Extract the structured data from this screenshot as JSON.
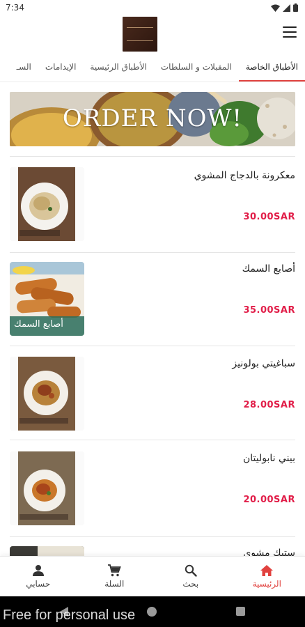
{
  "status_bar": {
    "time": "7:34"
  },
  "header": {
    "logo_icon": "restaurant-logo",
    "menu_icon": "hamburger-icon"
  },
  "tabs": [
    {
      "label": "الأطباق الخاصة",
      "active": true
    },
    {
      "label": "المقبلات و السلطات",
      "active": false
    },
    {
      "label": "الأطباق الرئيسية",
      "active": false
    },
    {
      "label": "الإيدامات",
      "active": false
    },
    {
      "label": "السـ",
      "active": false
    }
  ],
  "banner": {
    "text": "ORDER NOW!"
  },
  "items": [
    {
      "name": "معكرونة بالدجاج المشوي",
      "price": "30.00SAR"
    },
    {
      "name": "أصابع السمك",
      "price": "35.00SAR",
      "thumb_caption": "أصابع السمك"
    },
    {
      "name": "سباغيتي بولونيز",
      "price": "28.00SAR"
    },
    {
      "name": "بيني نابوليتان",
      "price": "20.00SAR"
    },
    {
      "name": "ستيك مشوي",
      "price": ""
    }
  ],
  "bottom_nav": [
    {
      "label": "الرئيسية",
      "icon": "home-icon",
      "active": true
    },
    {
      "label": "بحث",
      "icon": "search-icon",
      "active": false
    },
    {
      "label": "السلة",
      "icon": "cart-icon",
      "active": false
    },
    {
      "label": "حسابي",
      "icon": "person-icon",
      "active": false
    }
  ],
  "watermark": "Free for personal use",
  "colors": {
    "accent": "#e1423f",
    "price": "#e11d48"
  }
}
